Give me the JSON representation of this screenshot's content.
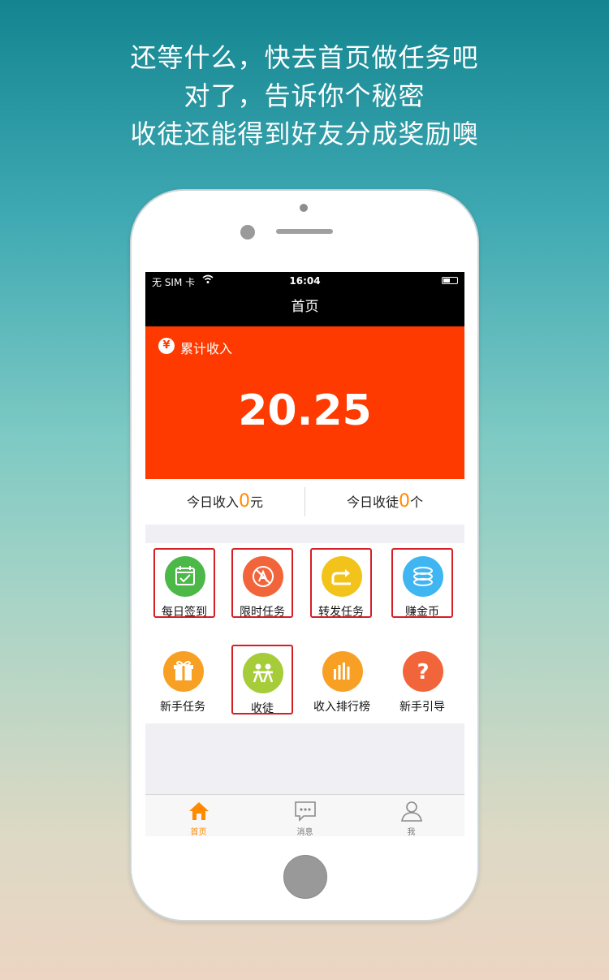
{
  "headline": {
    "line1": "还等什么，快去首页做任务吧",
    "line2": "对了，告诉你个秘密",
    "line3": "收徒还能得到好友分成奖励噢"
  },
  "status_bar": {
    "carrier": "无 SIM 卡",
    "time": "16:04"
  },
  "nav": {
    "title": "首页"
  },
  "income": {
    "label": "累计收入",
    "currency_symbol": "¥",
    "value": "20.25"
  },
  "stats": {
    "today_income_prefix": "今日收入",
    "today_income_value": "0",
    "today_income_unit": "元",
    "today_apprentice_prefix": "今日收徒",
    "today_apprentice_value": "0",
    "today_apprentice_unit": "个"
  },
  "grid": [
    {
      "label": "每日签到",
      "icon": "calendar-check-icon",
      "color": "#4cb847",
      "boxed": true
    },
    {
      "label": "限时任务",
      "icon": "app-store-icon",
      "color": "#f2653a",
      "boxed": true
    },
    {
      "label": "转发任务",
      "icon": "share-icon",
      "color": "#f2c31b",
      "boxed": true
    },
    {
      "label": "赚金币",
      "icon": "coins-icon",
      "color": "#3fb6f2",
      "boxed": true
    },
    {
      "label": "新手任务",
      "icon": "gift-icon",
      "color": "#f7a024",
      "boxed": false
    },
    {
      "label": "收徒",
      "icon": "people-icon",
      "color": "#a6cc3a",
      "boxed": true
    },
    {
      "label": "收入排行榜",
      "icon": "bar-chart-icon",
      "color": "#f7a024",
      "boxed": false
    },
    {
      "label": "新手引导",
      "icon": "question-icon",
      "color": "#f2653a",
      "boxed": false
    }
  ],
  "tabbar": [
    {
      "label": "首页",
      "icon": "home-icon",
      "active": true
    },
    {
      "label": "消息",
      "icon": "message-icon",
      "active": false
    },
    {
      "label": "我",
      "icon": "person-icon",
      "active": false
    }
  ],
  "colors": {
    "income_bg": "#ff3a00",
    "accent": "#ff8a00",
    "highlight_box": "#d51f25"
  }
}
